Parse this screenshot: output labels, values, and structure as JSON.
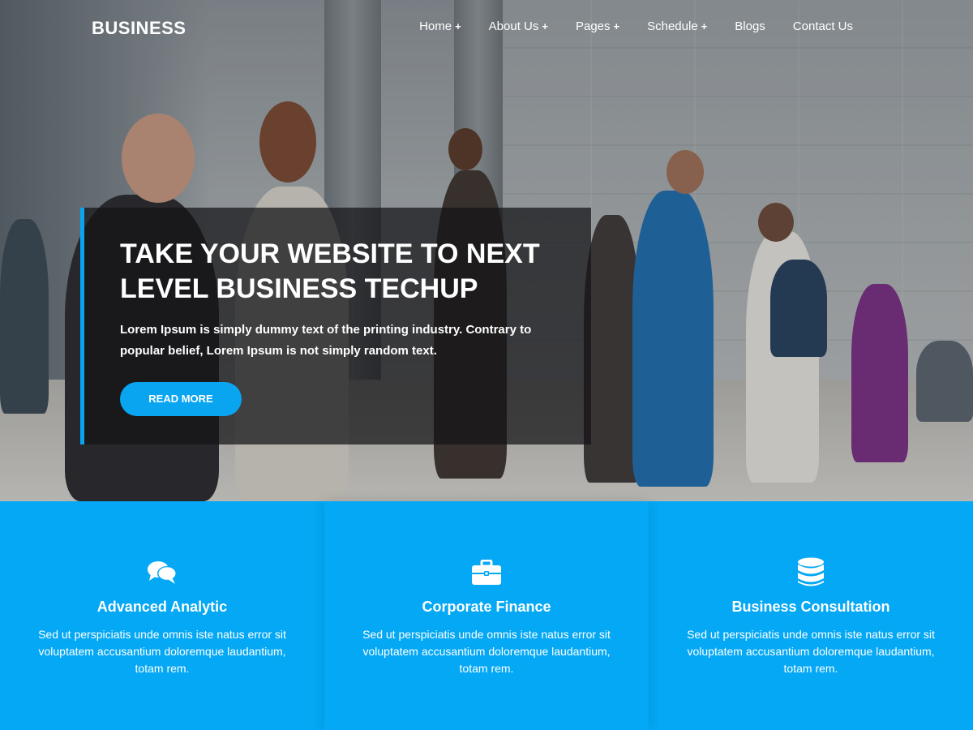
{
  "brand": {
    "logo": "BUSINESS"
  },
  "nav": {
    "items": [
      {
        "label": "Home",
        "has_submenu": true
      },
      {
        "label": "About Us",
        "has_submenu": true
      },
      {
        "label": "Pages",
        "has_submenu": true
      },
      {
        "label": "Schedule",
        "has_submenu": true
      },
      {
        "label": "Blogs",
        "has_submenu": false
      },
      {
        "label": "Contact Us",
        "has_submenu": false
      }
    ],
    "submenu_indicator": "+"
  },
  "hero": {
    "title": "TAKE YOUR WEBSITE TO NEXT LEVEL BUSINESS TECHUP",
    "text": "Lorem Ipsum is simply dummy text of the printing industry. Contrary to popular belief, Lorem Ipsum is not simply random text.",
    "button_label": "READ MORE"
  },
  "features": [
    {
      "icon": "chat-bubbles-icon",
      "title": "Advanced Analytic",
      "text": "Sed ut perspiciatis unde omnis iste natus error sit voluptatem accusantium doloremque laudantium, totam rem."
    },
    {
      "icon": "briefcase-icon",
      "title": "Corporate Finance",
      "text": "Sed ut perspiciatis unde omnis iste natus error sit voluptatem accusantium doloremque laudantium, totam rem."
    },
    {
      "icon": "database-icon",
      "title": "Business Consultation",
      "text": "Sed ut perspiciatis unde omnis iste natus error sit voluptatem accusantium doloremque laudantium, totam rem."
    }
  ],
  "colors": {
    "accent": "#04a8f4",
    "button": "#0aa5f1",
    "hero_box": "#141416"
  }
}
